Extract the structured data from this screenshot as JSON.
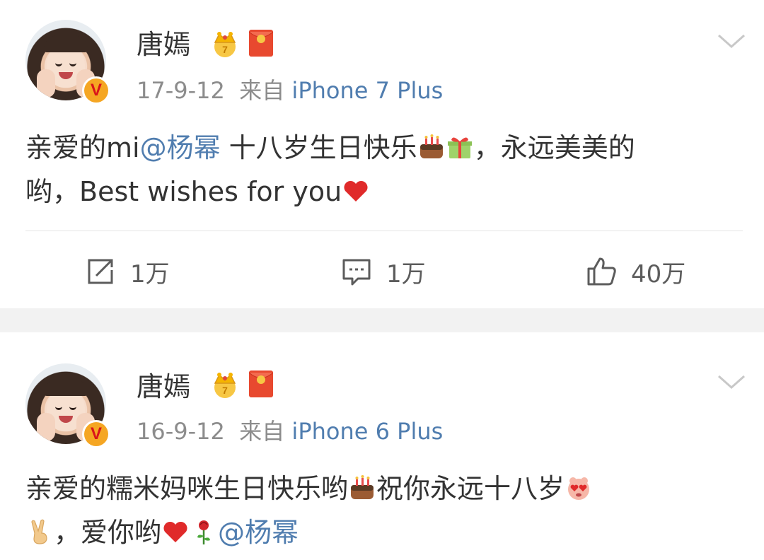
{
  "posts": [
    {
      "author": "唐嫣",
      "date": "17-9-12",
      "from_label": "来自",
      "source": "iPhone 7 Plus",
      "text": {
        "p1": "亲爱的mi",
        "mention": "@杨幂",
        "p2": " 十八岁生日快乐",
        "p3": "，永远美美的",
        "p4": "哟，Best wishes for you"
      },
      "stats": {
        "repost": "1万",
        "comment": "1万",
        "like": "40万"
      }
    },
    {
      "author": "唐嫣",
      "date": "16-9-12",
      "from_label": "来自",
      "source": "iPhone 6 Plus",
      "text": {
        "p1": "亲爱的糯米妈咪生日快乐哟",
        "p2": "祝你永远十八岁",
        "p3": "，爱你哟",
        "mention": "@杨幂"
      }
    }
  ],
  "icons": {
    "verified": "verified-v-badge",
    "crown": "crown-icon",
    "red_packet": "red-packet-icon",
    "more": "chevron-down-icon",
    "repost": "repost-icon",
    "comment": "comment-icon",
    "like": "like-icon"
  },
  "colors": {
    "link": "#507daf",
    "meta": "#8c8c8c",
    "text": "#333333",
    "verified_bg": "#f5a623",
    "verified_v": "#d9131a"
  }
}
